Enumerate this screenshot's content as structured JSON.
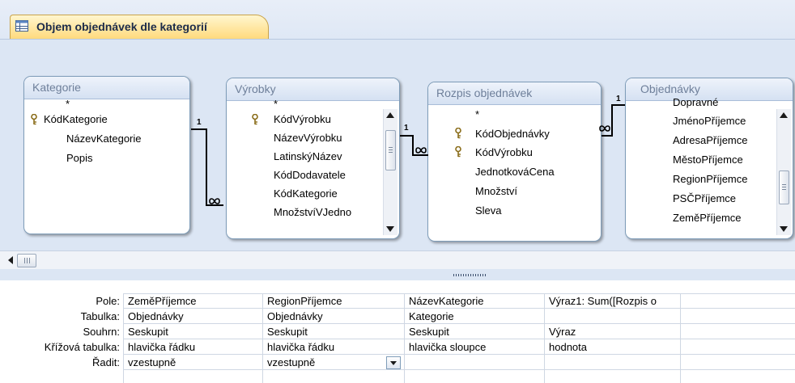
{
  "tab": {
    "title": "Objem objednávek dle kategorií"
  },
  "tables": {
    "kategorie": {
      "title": "Kategorie",
      "fields": [
        "*",
        "KódKategorie",
        "NázevKategorie",
        "Popis"
      ]
    },
    "vyrobky": {
      "title": "Výrobky",
      "fields": [
        "*",
        "KódVýrobku",
        "NázevVýrobku",
        "LatinskýNázev",
        "KódDodavatele",
        "KódKategorie",
        "MnožstvíVJedno"
      ]
    },
    "rozpis": {
      "title": "Rozpis objednávek",
      "fields": [
        "*",
        "KódObjednávky",
        "KódVýrobku",
        "JednotkováCena",
        "Množství",
        "Sleva"
      ]
    },
    "objednavky": {
      "title": "Objednávky",
      "fields": [
        "Dopravné",
        "JménoPříjemce",
        "AdresaPříjemce",
        "MěstoPříjemce",
        "RegionPříjemce",
        "PSČPříjemce",
        "ZeměPříjemce"
      ]
    }
  },
  "relations": {
    "one": "1",
    "many": "∞"
  },
  "grid": {
    "row_labels": [
      "Pole:",
      "Tabulka:",
      "Souhrn:",
      "Křížová tabulka:",
      "Řadit:"
    ],
    "columns": [
      [
        "ZeměPříjemce",
        "Objednávky",
        "Seskupit",
        "hlavička řádku",
        "vzestupně"
      ],
      [
        "RegionPříjemce",
        "Objednávky",
        "Seskupit",
        "hlavička řádku",
        "vzestupně"
      ],
      [
        "NázevKategorie",
        "Kategorie",
        "Seskupit",
        "hlavička sloupce",
        ""
      ],
      [
        "Výraz1: Sum([Rozpis o",
        "",
        "Výraz",
        "hodnota",
        ""
      ],
      [
        "",
        "",
        "",
        "",
        ""
      ]
    ]
  },
  "icons": {
    "tab": "query-design-icon",
    "key": "primary-key-icon"
  },
  "colors": {
    "tab": "#ffd97a",
    "accent": "#1b2b4a"
  }
}
